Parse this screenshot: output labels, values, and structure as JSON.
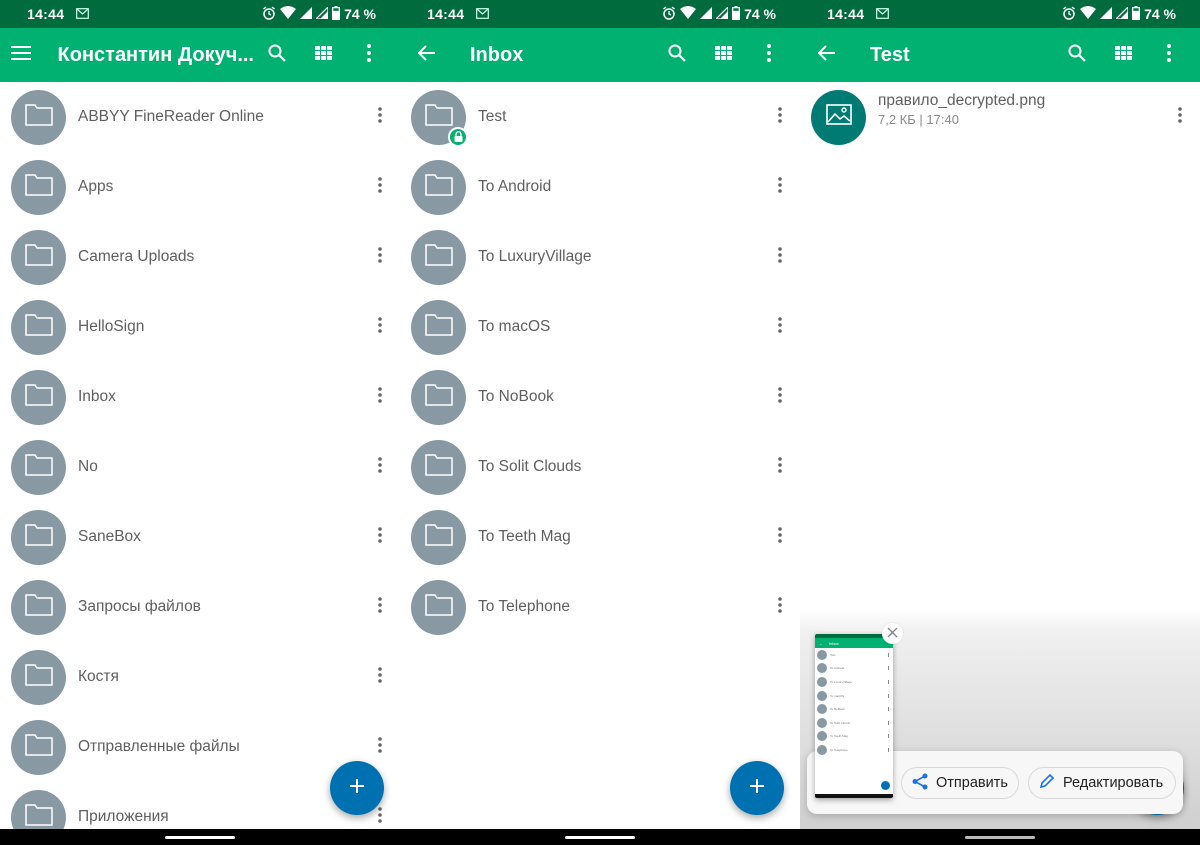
{
  "status_bar": {
    "time": "14:44",
    "battery": "74 %",
    "icons": [
      "gmail-icon",
      "alarm-icon",
      "wifi-icon",
      "signal-icon",
      "signal-icon",
      "battery-icon"
    ]
  },
  "colors": {
    "status_bar": "#006b3c",
    "app_bar": "#00b172",
    "folder_avatar": "#8899a4",
    "file_avatar": "#007b74",
    "fab": "#0071b0",
    "text": "#5f5f5f"
  },
  "screens": [
    {
      "title": "Константин Докуч...",
      "nav_icon": "menu-icon",
      "actions": [
        "search-icon",
        "grid-view-icon",
        "more-vert-icon"
      ],
      "items": [
        {
          "label": "ABBYY FineReader Online"
        },
        {
          "label": "Apps"
        },
        {
          "label": "Camera Uploads"
        },
        {
          "label": "HelloSign"
        },
        {
          "label": "Inbox"
        },
        {
          "label": "No"
        },
        {
          "label": "SaneBox"
        },
        {
          "label": "Запросы файлов"
        },
        {
          "label": "Костя"
        },
        {
          "label": "Отправленные файлы"
        },
        {
          "label": "Приложения"
        }
      ],
      "fab_icon": "add-icon"
    },
    {
      "title": "Inbox",
      "nav_icon": "back-arrow-icon",
      "actions": [
        "search-icon",
        "grid-view-icon",
        "more-vert-icon"
      ],
      "items": [
        {
          "label": "Test",
          "locked": true
        },
        {
          "label": "To Android"
        },
        {
          "label": "To LuxuryVillage"
        },
        {
          "label": "To macOS"
        },
        {
          "label": "To NoBook"
        },
        {
          "label": "To Solit Clouds"
        },
        {
          "label": "To Teeth Mag"
        },
        {
          "label": "To Telephone"
        }
      ],
      "fab_icon": "add-icon"
    },
    {
      "title": "Test",
      "nav_icon": "back-arrow-icon",
      "actions": [
        "search-icon",
        "grid-view-icon",
        "more-vert-icon"
      ],
      "files": [
        {
          "name": "правило_decrypted.png",
          "meta": "7,2 КБ | 17:40"
        }
      ],
      "screenshot_overlay": {
        "thumbnail_title": "Inbox",
        "thumbnail_items": [
          "Test",
          "To Android",
          "To LuxuryVillage",
          "To macOS",
          "To NoBook",
          "To Solit Clouds",
          "To Teeth Mag",
          "To Telephone"
        ],
        "send_label": "Отправить",
        "edit_label": "Редактировать"
      }
    }
  ]
}
